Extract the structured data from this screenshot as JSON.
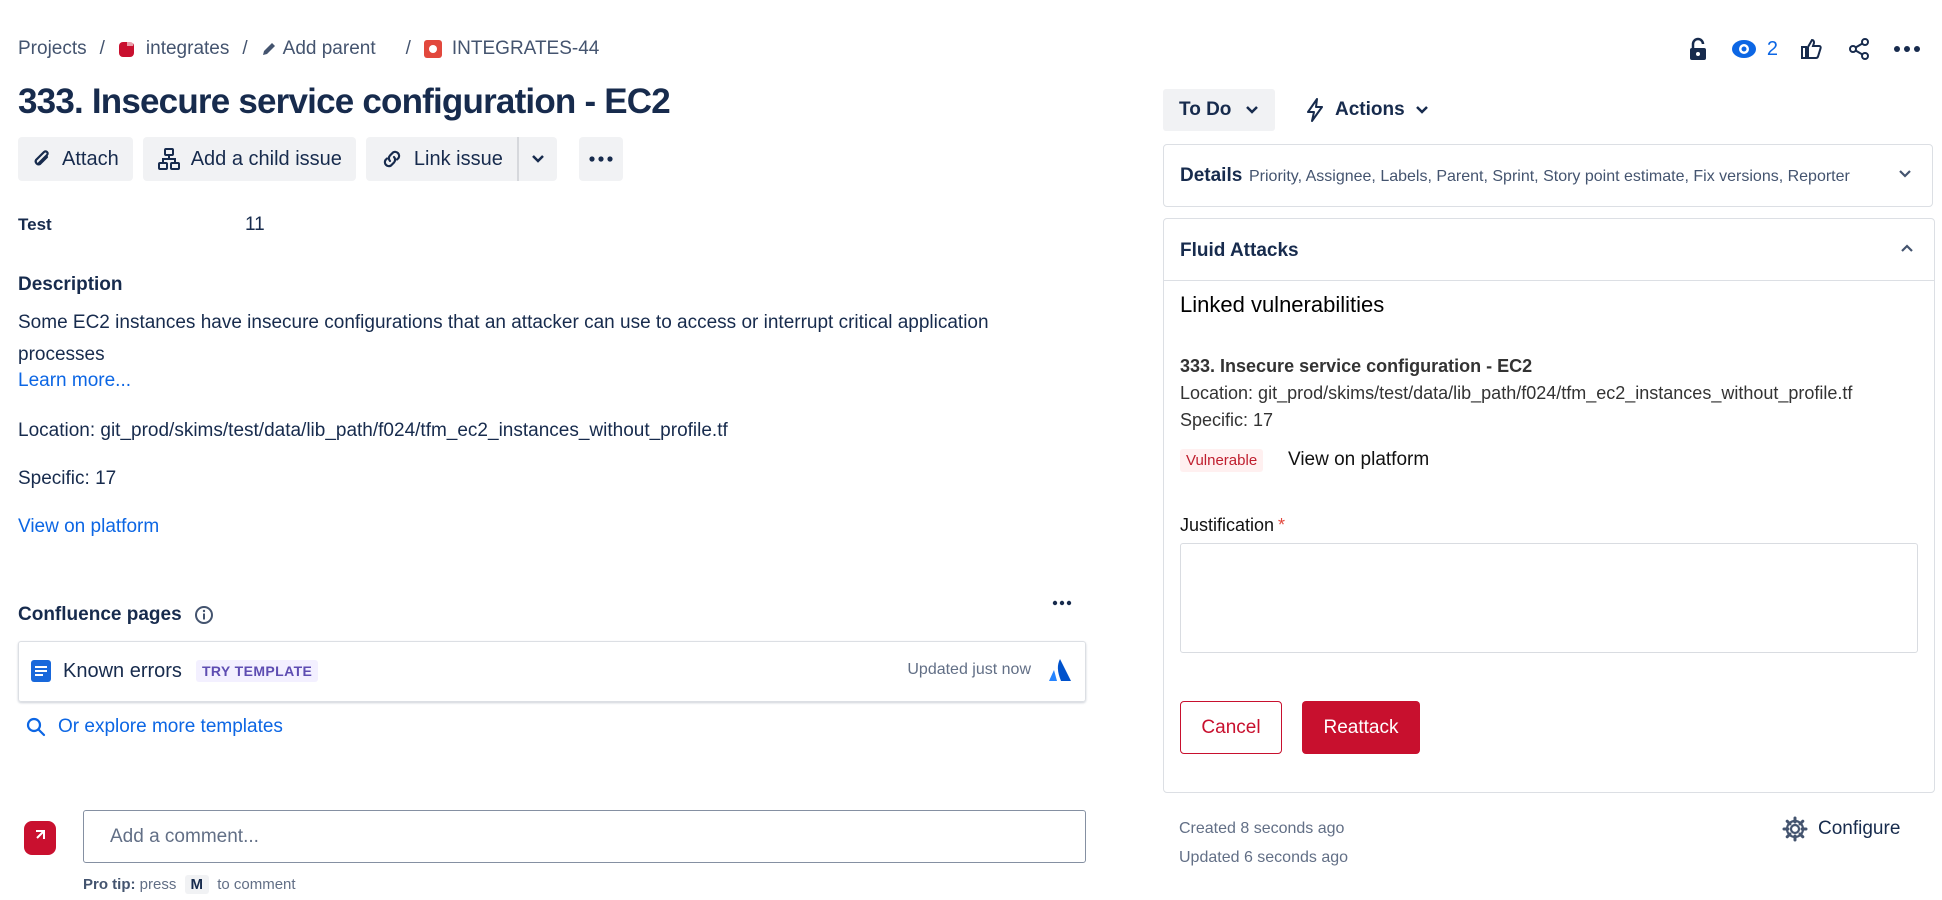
{
  "breadcrumb": {
    "projects": "Projects",
    "project": "integrates",
    "add_parent": "Add parent",
    "issue_key": "INTEGRATES-44"
  },
  "top_actions": {
    "watchers_count": "2"
  },
  "issue": {
    "title": "333. Insecure service configuration - EC2"
  },
  "toolbar": {
    "attach": "Attach",
    "add_child": "Add a child issue",
    "link_issue": "Link issue"
  },
  "fields": {
    "test_label": "Test",
    "test_value": "11"
  },
  "description": {
    "heading": "Description",
    "text": "Some EC2 instances have insecure configurations that an attacker can use to access or interrupt critical application processes",
    "learn_more": "Learn more...",
    "location": "Location: git_prod/skims/test/data/lib_path/f024/tfm_ec2_instances_without_profile.tf",
    "specific": "Specific: 17",
    "view_on_platform": "View on platform"
  },
  "confluence": {
    "heading": "Confluence pages",
    "page_title": "Known errors",
    "badge": "TRY TEMPLATE",
    "updated": "Updated just now",
    "explore": "Or explore more templates"
  },
  "comment": {
    "placeholder": "Add a comment...",
    "pro_tip_label": "Pro tip:",
    "pro_tip_press": "press",
    "pro_tip_key": "M",
    "pro_tip_suffix": "to comment"
  },
  "status": {
    "current": "To Do",
    "actions": "Actions"
  },
  "details": {
    "title": "Details",
    "summary": "Priority, Assignee, Labels, Parent, Sprint, Story point estimate, Fix versions, Reporter"
  },
  "fluid_attacks": {
    "title": "Fluid Attacks",
    "linked_heading": "Linked vulnerabilities",
    "vuln_title": "333. Insecure service configuration - EC2",
    "vuln_location": "Location: git_prod/skims/test/data/lib_path/f024/tfm_ec2_instances_without_profile.tf",
    "vuln_specific": "Specific: 17",
    "vuln_state": "Vulnerable",
    "view_on_platform": "View on platform",
    "justification_label": "Justification",
    "required_mark": "*",
    "cancel": "Cancel",
    "reattack": "Reattack"
  },
  "meta": {
    "created": "Created 8 seconds ago",
    "updated": "Updated 6 seconds ago",
    "configure": "Configure"
  },
  "colors": {
    "brand_red": "#c8102e",
    "link_blue": "#0c66e4",
    "text": "#172b4d"
  }
}
